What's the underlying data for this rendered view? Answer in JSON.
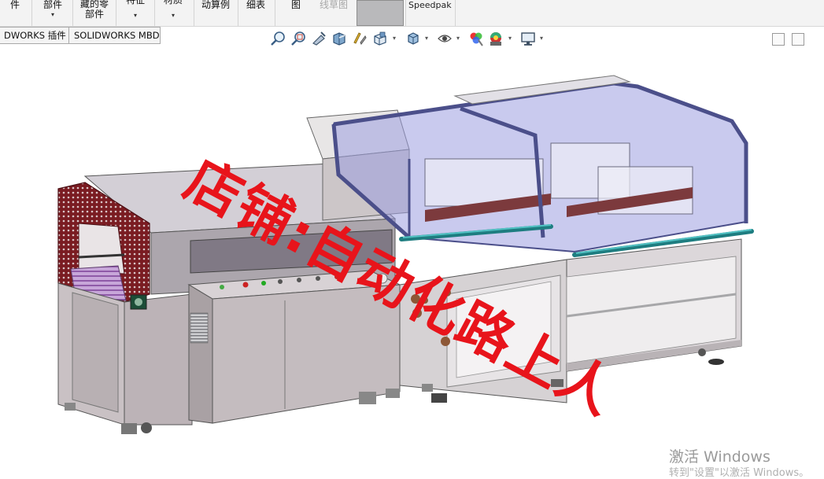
{
  "ribbon": {
    "items": [
      {
        "label": "件",
        "arrow": ""
      },
      {
        "label": "部件",
        "arrow": "▾"
      },
      {
        "label_line1": "藏的零",
        "label_line2": "部件",
        "arrow": ""
      },
      {
        "label": "特征",
        "arrow": "▾"
      },
      {
        "label": "材质",
        "arrow": "▾"
      },
      {
        "label": "动算例",
        "arrow": ""
      },
      {
        "label": "细表",
        "arrow": ""
      },
      {
        "label": "图",
        "arrow": ""
      },
      {
        "label": "线草图",
        "arrow": "",
        "disabled": true
      }
    ],
    "speedpak_label": "Speedpak"
  },
  "tabs": [
    {
      "label": "DWORKS 插件"
    },
    {
      "label": "SOLIDWORKS MBD"
    }
  ],
  "hud_icons": [
    "zoom-to-fit-icon",
    "zoom-to-area-icon",
    "previous-view-icon",
    "section-view-icon",
    "dynamic-annotation-icon",
    "view-orientation-icon",
    "display-style-icon",
    "hide-show-items-icon",
    "edit-appearance-icon",
    "apply-scene-icon",
    "view-settings-icon"
  ],
  "watermark": {
    "text": "店铺:自动化路上人",
    "color": "#e8141b"
  },
  "windows_activation": {
    "line1": "激活 Windows",
    "line2": "转到\"设置\"以激活 Windows。"
  },
  "colors": {
    "ribbon_bg": "#f3f3f3",
    "machine_frame": "#7a1c22",
    "guard_glass": "#9c9ee0",
    "guard_frame": "#4b4f8a",
    "rail": "#2fa6a8",
    "body_gray": "#c9c1c4"
  }
}
